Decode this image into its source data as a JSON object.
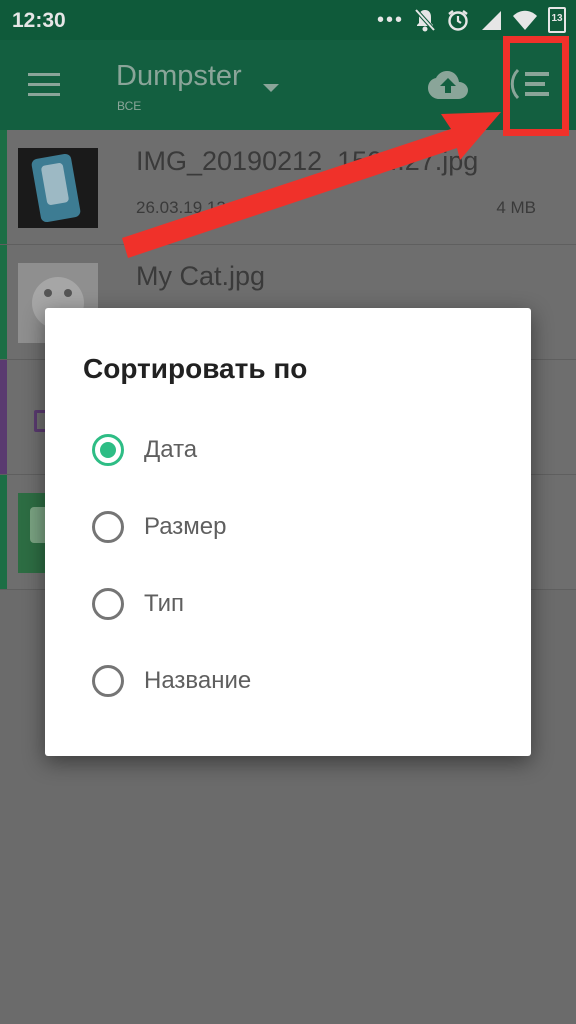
{
  "status_bar": {
    "time": "12:30",
    "more_icon": "more-dots-icon",
    "battery_level": "13",
    "icons": [
      "notifications-off-icon",
      "alarm-icon",
      "signal-icon",
      "wifi-icon",
      "battery-icon"
    ]
  },
  "toolbar": {
    "title": "Dumpster",
    "subtitle": "ВСЕ",
    "icons": [
      "menu-icon",
      "dropdown-icon",
      "cloud-upload-icon",
      "sort-icon"
    ]
  },
  "files": [
    {
      "name": "IMG_20190212_150...27.jpg",
      "date": "26.03.19 12:07",
      "size": "4 MB",
      "stripe_color": "#1c6e45"
    },
    {
      "name": "My Cat.jpg",
      "date": "",
      "size": "",
      "stripe_color": "#1c6e45"
    },
    {
      "name": "",
      "date": "",
      "size": "",
      "stripe_color": "#5a3a70"
    },
    {
      "name": "",
      "date": "",
      "size": "",
      "stripe_color": "#1c6e45"
    }
  ],
  "sort_dialog": {
    "title": "Сортировать по",
    "options": [
      {
        "label": "Дата",
        "checked": true
      },
      {
        "label": "Размер",
        "checked": false
      },
      {
        "label": "Тип",
        "checked": false
      },
      {
        "label": "Название",
        "checked": false
      }
    ]
  },
  "colors": {
    "toolbar": "#135f40",
    "accent": "#2ebd85",
    "annotation": "#f0312a"
  }
}
